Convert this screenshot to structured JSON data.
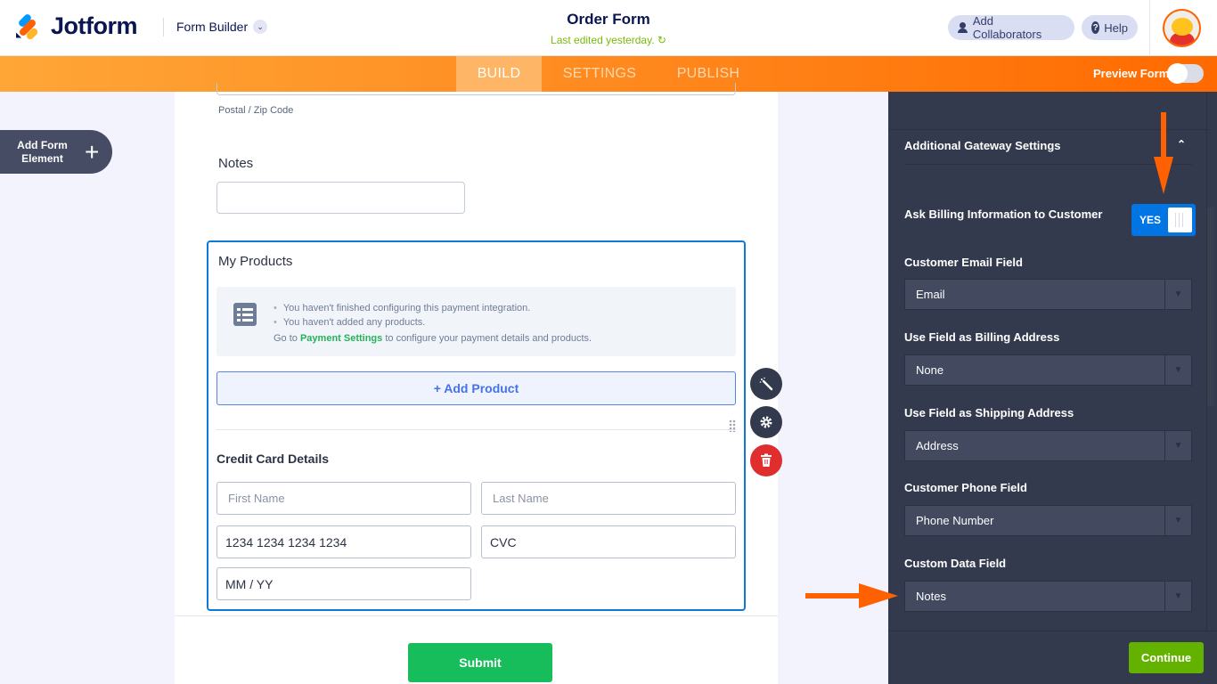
{
  "header": {
    "brand": "Jotform",
    "builder_label": "Form Builder",
    "form_title": "Order Form",
    "last_edited": "Last edited yesterday.",
    "collaborators_label": "Add Collaborators",
    "help_label": "Help"
  },
  "nav": {
    "tabs": [
      {
        "label": "BUILD",
        "active": true
      },
      {
        "label": "SETTINGS",
        "active": false
      },
      {
        "label": "PUBLISH",
        "active": false
      }
    ],
    "preview_label": "Preview Form",
    "preview_on": false
  },
  "left": {
    "add_element_label": "Add Form Element",
    "add_element_line1": "Add Form",
    "add_element_line2": "Element"
  },
  "form": {
    "postal_label": "Postal / Zip Code",
    "notes_label": "Notes",
    "notes_value": "",
    "products": {
      "title": "My Products",
      "notices": [
        "You haven't finished configuring this payment integration.",
        "You haven't added any products."
      ],
      "go_prefix": "Go to ",
      "go_link": "Payment Settings",
      "go_suffix": " to configure your payment details and products.",
      "add_product_label": "+ Add Product"
    },
    "credit_card": {
      "title": "Credit Card Details",
      "first_name_placeholder": "First Name",
      "last_name_placeholder": "Last Name",
      "card_number": "1234 1234 1234 1234",
      "cvc": "CVC",
      "expiry": "MM / YY"
    },
    "submit_label": "Submit"
  },
  "tools": {
    "magic": "magic-wand-icon",
    "settings": "gear-icon",
    "delete": "trash-icon"
  },
  "panel": {
    "section_title": "Additional Gateway Settings",
    "billing_label": "Ask Billing Information to Customer",
    "billing_toggle": "YES",
    "fields": [
      {
        "label": "Customer Email Field",
        "value": "Email"
      },
      {
        "label": "Use Field as Billing Address",
        "value": "None"
      },
      {
        "label": "Use Field as Shipping Address",
        "value": "Address"
      },
      {
        "label": "Customer Phone Field",
        "value": "Phone Number"
      },
      {
        "label": "Custom Data Field",
        "value": "Notes"
      }
    ],
    "continue_label": "Continue"
  },
  "colors": {
    "brand_orange": "#ff6100",
    "accent_blue": "#0075e3",
    "success_green": "#18bd5b",
    "continue_green": "#64b200",
    "panel_bg": "#343a4e"
  }
}
